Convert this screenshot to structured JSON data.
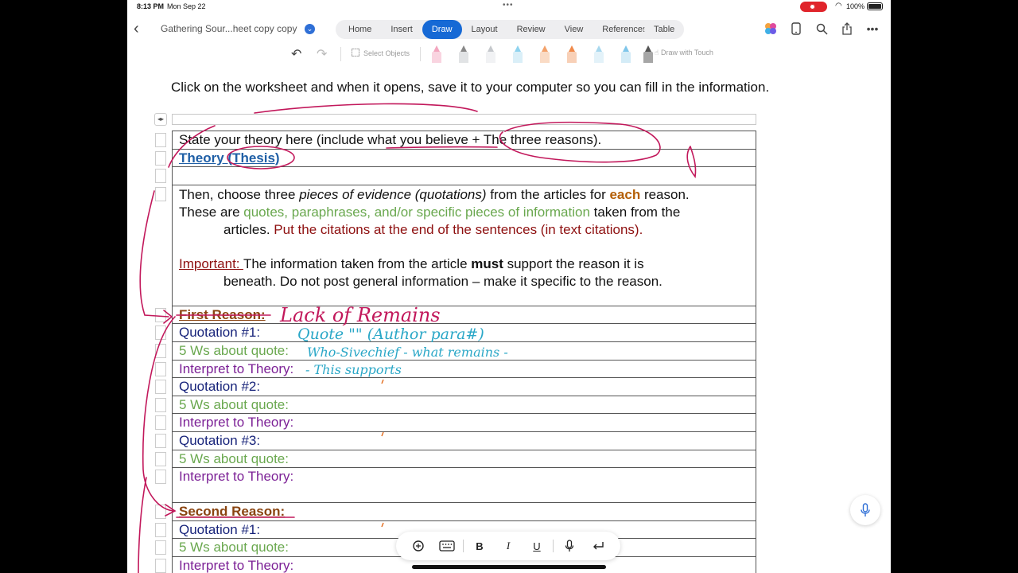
{
  "status_bar": {
    "time": "8:13 PM",
    "date": "Mon Sep 22",
    "battery": "100%"
  },
  "top_bar": {
    "doc_title": "Gathering Sour...heet copy copy",
    "tabs": [
      "Home",
      "Insert",
      "Draw",
      "Layout",
      "Review",
      "View",
      "References"
    ],
    "active_tab": "Draw",
    "table_tab": "Table",
    "icons": [
      "copilot-icon",
      "phone-icon",
      "search-icon",
      "share-icon",
      "more-icon"
    ]
  },
  "draw_toolbar": {
    "select_objects": "Select Objects",
    "draw_with_touch": "Draw with Touch",
    "pens": [
      {
        "name": "pen-pink",
        "color": "#f3a6bf"
      },
      {
        "name": "pen-gray",
        "color": "#9aa0a6"
      },
      {
        "name": "pen-light",
        "color": "#d5d7da"
      },
      {
        "name": "pen-light-blue",
        "color": "#8fd3ef"
      },
      {
        "name": "pen-orange",
        "color": "#f3a26b"
      },
      {
        "name": "pen-orange-2",
        "color": "#f08a4b"
      },
      {
        "name": "pen-sky",
        "color": "#a8d8ee"
      },
      {
        "name": "pen-sky-2",
        "color": "#7fc6ea"
      },
      {
        "name": "pen-dark",
        "color": "#444444"
      }
    ]
  },
  "document": {
    "instruction": "Click on the worksheet and when it opens, save it to your computer so you can fill in the information.",
    "theory_row": {
      "text": "State your theory here (include what you believe + The three reasons).",
      "label": "Theory (Thesis)"
    },
    "evidence_text": {
      "p1_a": "Then, choose three ",
      "p1_em": "pieces of evidence (quotations)",
      "p1_b": " from the articles for ",
      "p1_bold": "each",
      "p1_c": " reason.",
      "p2_a": "These are ",
      "p2_green": "quotes, paraphrases, and/or specific pieces of information",
      "p2_b": " taken from the",
      "p3_a": "articles. ",
      "p3_red": "Put the citations at the end of the sentences (in text citations).",
      "imp_label": "Important: ",
      "imp_a": "The information taken from the article ",
      "imp_bold": "must",
      "imp_b": " support the reason it is",
      "imp_c": "beneath. Do not post general information – make it specific to the reason."
    },
    "first_reason": {
      "label": "First Reason:",
      "rows": [
        "Quotation #1:",
        "5 Ws about quote:",
        "Interpret to Theory:",
        "Quotation #2:",
        "5 Ws about quote:",
        "Interpret to Theory:",
        "Quotation #3:",
        "5 Ws about quote:",
        "Interpret to Theory:"
      ]
    },
    "second_reason": {
      "label": "Second Reason:",
      "rows": [
        "Quotation #1:",
        "5 Ws about quote:",
        "Interpret to Theory:"
      ]
    }
  },
  "handwriting": {
    "first_reason": "Lack of Remains",
    "quote_line": "Quote \"\" (Author para#)",
    "five_ws_line": "Who-Sivechief - what remains -",
    "interpret_line": "- This supports"
  },
  "bottom_toolbar": {
    "items": [
      "B",
      "I",
      "U"
    ]
  }
}
